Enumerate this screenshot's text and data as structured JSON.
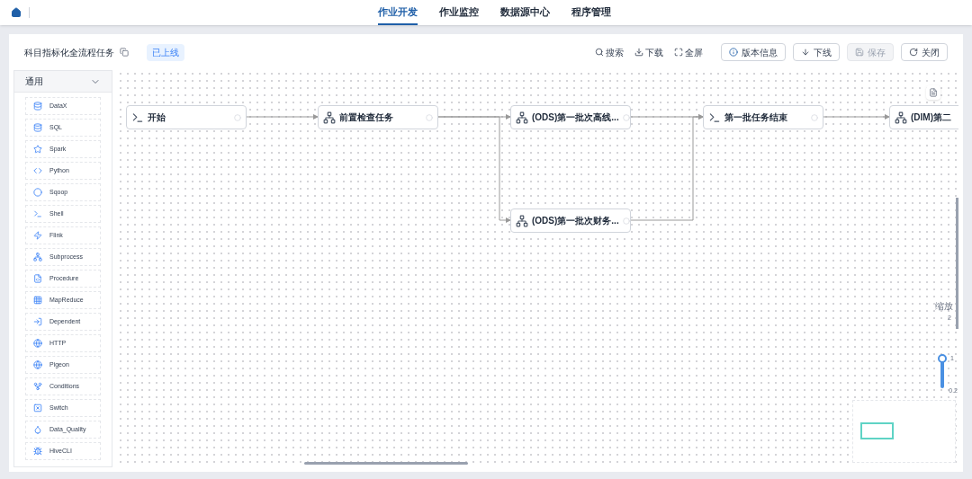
{
  "nav": {
    "tabs": [
      {
        "label": "作业开发",
        "selected": true
      },
      {
        "label": "作业监控",
        "selected": false
      },
      {
        "label": "数据源中心",
        "selected": false
      },
      {
        "label": "程序管理",
        "selected": false
      }
    ]
  },
  "header": {
    "title": "科目指标化全流程任务",
    "status": "已上线",
    "tools": [
      {
        "label": "搜索",
        "kind": "search"
      },
      {
        "label": "下载",
        "kind": "download"
      },
      {
        "label": "全屏",
        "kind": "fullscreen"
      }
    ],
    "buttons": [
      {
        "label": "版本信息",
        "kind": "info",
        "disabled": false
      },
      {
        "label": "下线",
        "kind": "down",
        "disabled": false
      },
      {
        "label": "保存",
        "kind": "save",
        "disabled": true
      },
      {
        "label": "关闭",
        "kind": "close",
        "disabled": false
      }
    ]
  },
  "sidebar": {
    "group": "通用",
    "expanded": true,
    "items": [
      "DataX",
      "SQL",
      "Spark",
      "Python",
      "Sqoop",
      "Shell",
      "Flink",
      "Subprocess",
      "Procedure",
      "MapReduce",
      "Dependent",
      "HTTP",
      "Pigeon",
      "Conditions",
      "Switch",
      "Data_Quality",
      "HiveCLI"
    ]
  },
  "nodes": [
    {
      "label": "开始",
      "kind": "shell"
    },
    {
      "label": "前置检查任务",
      "kind": "sub"
    },
    {
      "label": "(ODS)第一批次高线...",
      "kind": "sub"
    },
    {
      "label": "第一批任务结束",
      "kind": "shell"
    },
    {
      "label": "(DIM)第二",
      "kind": "sub"
    },
    {
      "label": "(ODS)第一批次财务...",
      "kind": "sub"
    }
  ],
  "zoom": {
    "label": "缩放",
    "max": "2",
    "current": "1",
    "min": "0.2",
    "level": 0.44
  }
}
